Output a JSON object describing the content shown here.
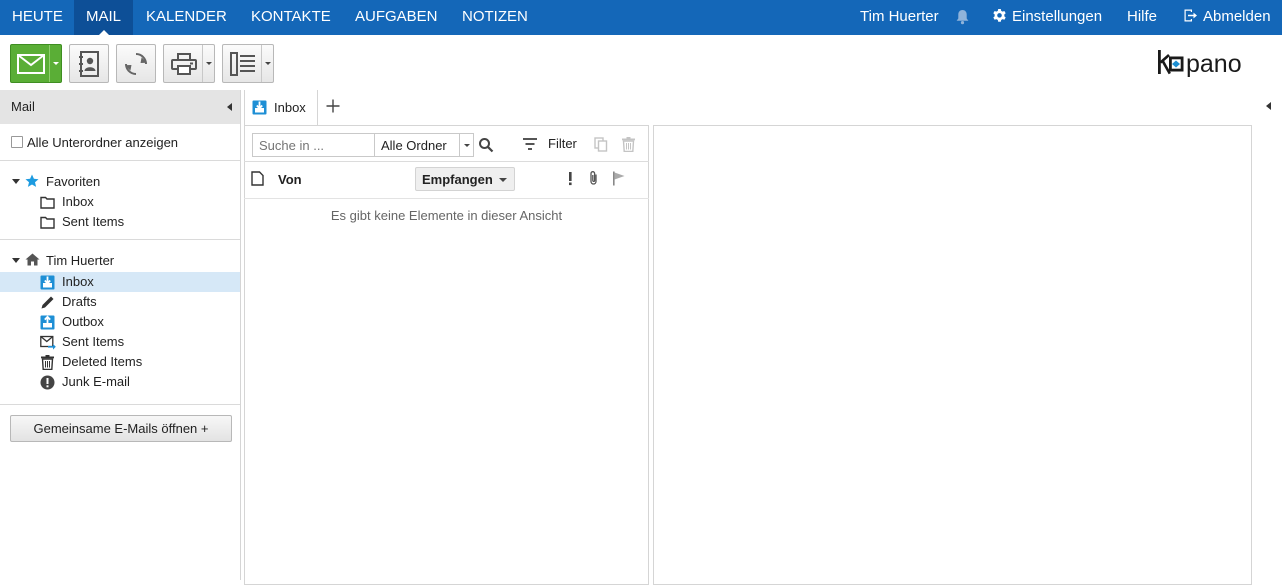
{
  "nav": {
    "tabs": [
      "HEUTE",
      "MAIL",
      "KALENDER",
      "KONTAKTE",
      "AUFGABEN",
      "NOTIZEN"
    ],
    "active_tab": "MAIL",
    "user": "Tim Huerter",
    "settings": "Einstellungen",
    "help": "Hilfe",
    "logout": "Abmelden"
  },
  "brand": {
    "logo": "kopano",
    "accent": "#1467b8",
    "new_mail_color": "#5aae36"
  },
  "toolbar": {
    "buttons": [
      "new-mail",
      "address-book",
      "refresh",
      "print",
      "view-layout"
    ]
  },
  "left": {
    "title": "Mail",
    "show_subfolders": "Alle Unterordner anzeigen",
    "favorites": {
      "label": "Favoriten",
      "items": [
        "Inbox",
        "Sent Items"
      ]
    },
    "store": {
      "label": "Tim Huerter",
      "items": [
        {
          "label": "Inbox",
          "icon": "inbox-icon",
          "selected": true
        },
        {
          "label": "Drafts",
          "icon": "drafts-icon"
        },
        {
          "label": "Outbox",
          "icon": "outbox-icon"
        },
        {
          "label": "Sent Items",
          "icon": "sent-items-icon"
        },
        {
          "label": "Deleted Items",
          "icon": "trash-icon"
        },
        {
          "label": "Junk E-mail",
          "icon": "junk-icon"
        }
      ]
    },
    "open_shared": "Gemeinsame E-Mails öffnen +"
  },
  "content": {
    "tab": "Inbox",
    "search_placeholder": "Suche in ...",
    "folder_scope": "Alle Ordner",
    "filter": "Filter",
    "columns": {
      "from": "Von",
      "received": "Empfangen"
    },
    "empty": "Es gibt keine Elemente in dieser Ansicht"
  }
}
